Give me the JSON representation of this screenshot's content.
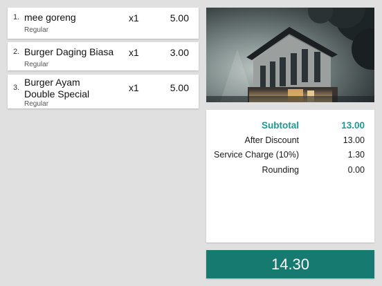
{
  "order_items": [
    {
      "index": "1.",
      "name": "mee goreng",
      "variant": "Regular",
      "qty": "x1",
      "price": "5.00"
    },
    {
      "index": "2.",
      "name": "Burger Daging Biasa",
      "variant": "Regular",
      "qty": "x1",
      "price": "3.00"
    },
    {
      "index": "3.",
      "name": "Burger Ayam Double Special",
      "variant": "Regular",
      "qty": "x1",
      "price": "5.00"
    }
  ],
  "summary": {
    "subtotal_label": "Subtotal",
    "subtotal_value": "13.00",
    "after_discount_label": "After Discount",
    "after_discount_value": "13.00",
    "service_charge_label": "Service Charge (10%)",
    "service_charge_value": "1.30",
    "rounding_label": "Rounding",
    "rounding_value": "0.00"
  },
  "total": "14.30",
  "colors": {
    "accent": "#1c9a91",
    "total_button": "#167a70",
    "background": "#e0e0e0"
  }
}
